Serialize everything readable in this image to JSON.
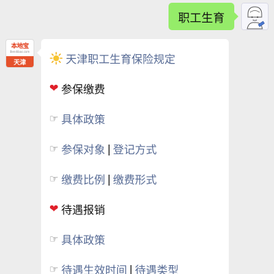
{
  "user_message": {
    "text": "职工生育"
  },
  "bot_avatar": {
    "name": "本地宝",
    "url": "Bendibao.com",
    "city": "天津"
  },
  "bot_message": {
    "title": "天津职工生育保险规定",
    "section1": {
      "heading": "参保缴费",
      "link1": "具体政策",
      "link2a": "参保对象",
      "link2b": "登记方式",
      "link3a": "缴费比例",
      "link3b": "缴费形式"
    },
    "section2": {
      "heading": "待遇报销",
      "link1": "具体政策",
      "link2a": "待遇生效时间",
      "link2b": "待遇类型"
    },
    "separator": "|",
    "pointer_glyph": "☞",
    "heart_glyph": "❤"
  },
  "icons": {
    "sun": "sun-icon",
    "heart": "heart-icon",
    "pointer": "pointing-hand-icon"
  },
  "colors": {
    "chat_background": "#ededed",
    "user_bubble": "#95ec69",
    "link": "#576b95",
    "heart": "#e0202a",
    "logo_orange": "#e5512b"
  }
}
